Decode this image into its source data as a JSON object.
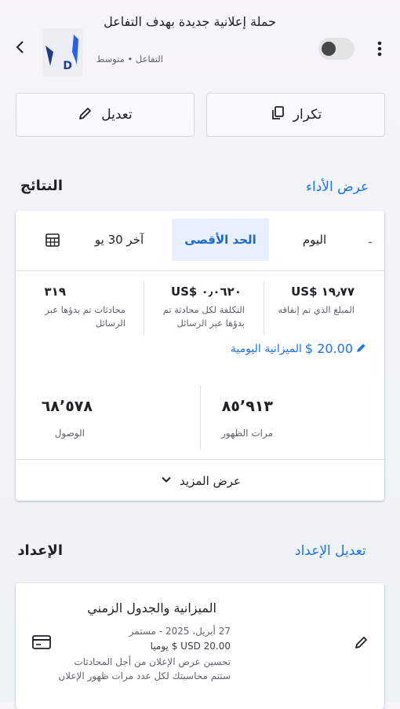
{
  "header": {
    "title": "حملة إعلانية جديدة بهدف التفاعل",
    "subtitle": "التفاعل • متوسط"
  },
  "actions": {
    "duplicate_label": "تكرار",
    "edit_label": "تعديل"
  },
  "results": {
    "title": "النتائج",
    "link": "عرض الأداء",
    "tabs": [
      "اليوم",
      "الحد الأقصى",
      "آخر 30 يو"
    ],
    "selected_tab": "الحد الأقصى",
    "metrics": [
      {
        "value": "US$ ١٩٫٧٧",
        "label": "المبلغ الذي تم إنفاقه"
      },
      {
        "value": "US$ ٠٫٠٦٢٠",
        "label": "التكلفة لكل محادثة تم بدؤها عبر الرسائل"
      },
      {
        "value": "٣١٩",
        "label": "محادثات تم بدؤها عبر الرسائل"
      }
    ],
    "daily_budget_amount": "20.00 $",
    "daily_budget_label": "الميزانية اليومية",
    "impressions": {
      "value": "٨٥٬٩١٣",
      "label": "مرات الظهور"
    },
    "reach": {
      "value": "٦٨٬٥٧٨",
      "label": "الوصول"
    },
    "see_more": "عرض المزيد"
  },
  "setup": {
    "title": "الإعداد",
    "link": "تعديل الإعداد",
    "card_title": "الميزانية والجدول الزمني",
    "date_line": "27 أبريل، 2025 - مستمر",
    "budget_line": "20.00 USD $ يوميا",
    "optimization_line1": "تحسين عرض الإعلان من أجل المحادثات",
    "optimization_line2": "ستتم محاسبتك لكل عدد مرات ظهور الإعلان"
  },
  "icons": {
    "back": "chevron-left-icon",
    "more": "more-vert-icon",
    "duplicate": "copy-icon",
    "edit": "pencil-icon",
    "calendar": "calendar-icon",
    "expand": "chevron-down-icon",
    "billing": "credit-card-icon"
  },
  "colors": {
    "accent": "#1a73e8",
    "selected_tab_bg": "#e8f0fe",
    "text": "#202124",
    "muted": "#5f6368"
  }
}
